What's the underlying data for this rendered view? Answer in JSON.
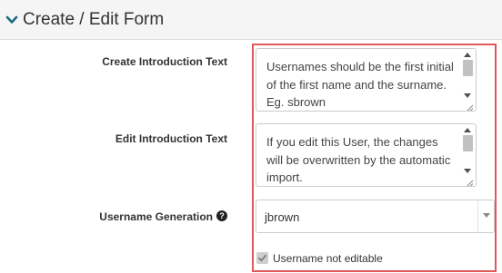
{
  "panel": {
    "title": "Create / Edit Form",
    "chevron_icon": "chevron-down-icon",
    "accent_color": "#1a6b7c"
  },
  "fields": {
    "create_intro": {
      "label": "Create Introduction Text",
      "value": "Usernames should be the first initial of the first name and the surname. Eg. sbrown"
    },
    "edit_intro": {
      "label": "Edit Introduction Text",
      "value": "If you edit this User, the changes will be overwritten by the automatic import."
    },
    "username_generation": {
      "label": "Username Generation",
      "help_icon": "question-circle-icon",
      "help_glyph": "?",
      "selected": "jbrown"
    },
    "username_not_editable": {
      "label": "Username not editable",
      "checked": true,
      "disabled": true
    }
  },
  "highlight_color": "#e0585a"
}
